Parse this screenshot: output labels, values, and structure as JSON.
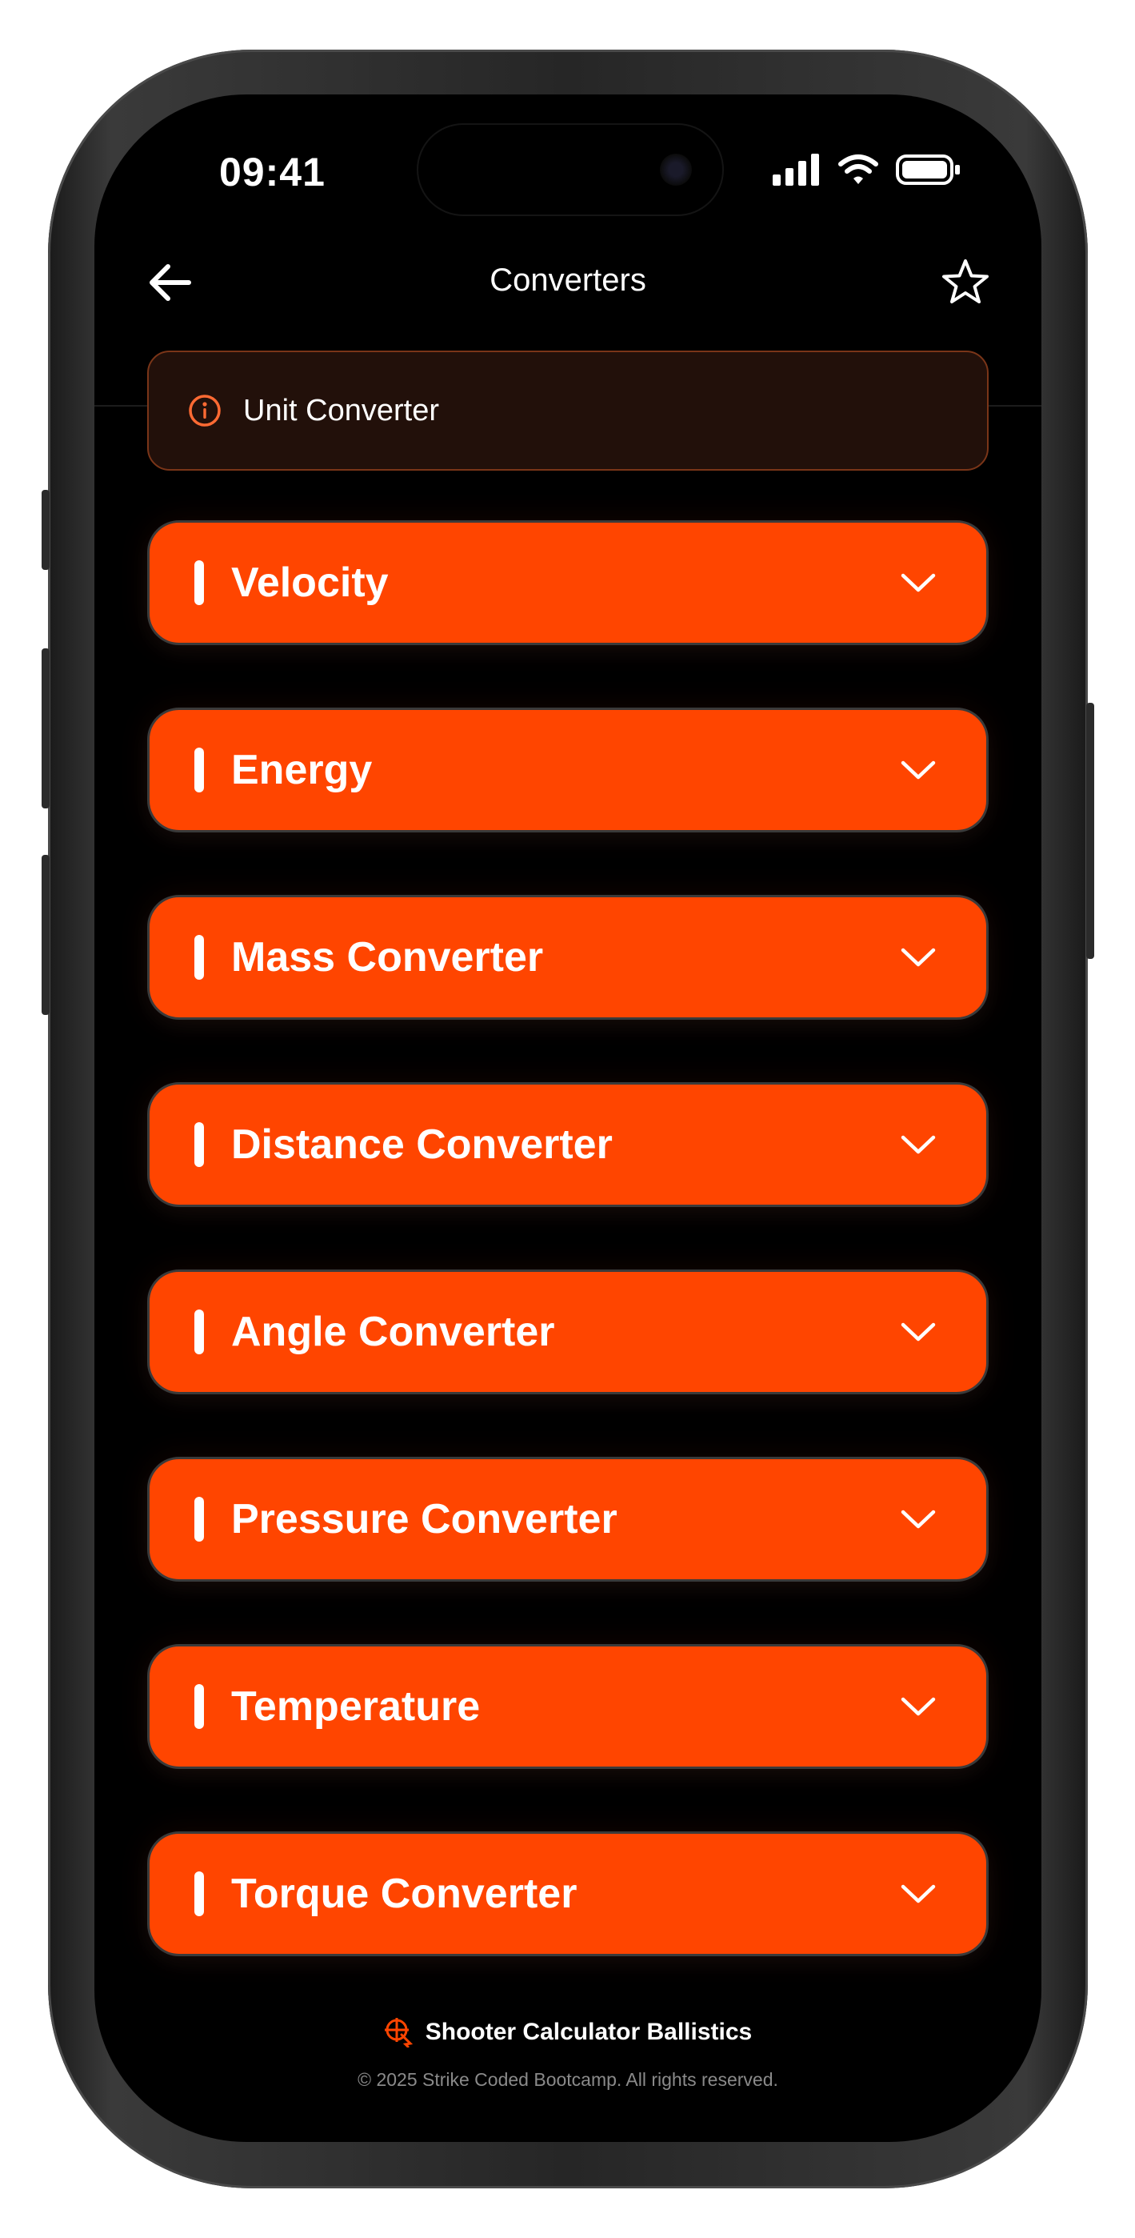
{
  "status_bar": {
    "time": "09:41"
  },
  "nav": {
    "title": "Converters",
    "back_icon": "arrow-left-icon",
    "favorite_icon": "star-icon"
  },
  "info_banner": {
    "text": "Unit Converter",
    "icon": "info-circle-icon"
  },
  "converters": [
    {
      "label": "Velocity"
    },
    {
      "label": "Energy"
    },
    {
      "label": "Mass Converter"
    },
    {
      "label": "Distance Converter"
    },
    {
      "label": "Angle Converter"
    },
    {
      "label": "Pressure Converter"
    },
    {
      "label": "Temperature"
    },
    {
      "label": "Torque Converter"
    }
  ],
  "footer": {
    "brand": "Shooter Calculator Ballistics",
    "copyright": "© 2025 Strike Coded Bootcamp. All rights reserved."
  },
  "colors": {
    "accent": "#ff4500",
    "background": "#000000",
    "banner_bg": "#22100a",
    "banner_border": "#7a3518",
    "text_primary": "#ffffff",
    "text_muted": "#8a8a8a"
  }
}
